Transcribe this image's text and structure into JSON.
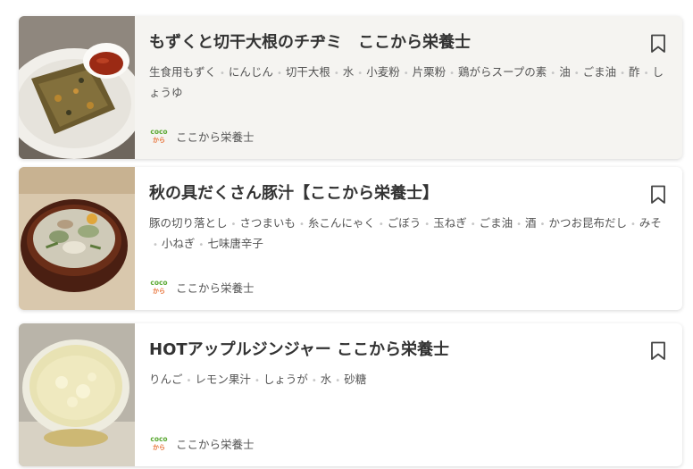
{
  "recipes": [
    {
      "title": "もずくと切干大根のチヂミ　ここから栄養士",
      "ingredients": [
        "生食用もずく",
        "にんじん",
        "切干大根",
        "水",
        "小麦粉",
        "片栗粉",
        "鶏がらスープの素",
        "油",
        "ごま油",
        "酢",
        "しょうゆ"
      ],
      "author": "ここから栄養士",
      "bookmark_icon": "bookmark-icon",
      "highlighted": true
    },
    {
      "title": "秋の具だくさん豚汁【ここから栄養士】",
      "ingredients": [
        "豚の切り落とし",
        "さつまいも",
        "糸こんにゃく",
        "ごぼう",
        "玉ねぎ",
        "ごま油",
        "酒",
        "かつお昆布だし",
        "みそ",
        "小ねぎ",
        "七味唐辛子"
      ],
      "author": "ここから栄養士",
      "bookmark_icon": "bookmark-icon",
      "highlighted": false
    },
    {
      "title": "HOTアップルジンジャー ここから栄養士",
      "ingredients": [
        "りんご",
        "レモン果汁",
        "しょうが",
        "水",
        "砂糖"
      ],
      "author": "ここから栄養士",
      "bookmark_icon": "bookmark-icon",
      "highlighted": false
    }
  ],
  "author_logo": {
    "text_top": "coco",
    "text_bottom": "から"
  },
  "colors": {
    "logo_green": "#5aa832",
    "logo_orange": "#e8743b",
    "card_highlight": "#f5f4f1"
  }
}
